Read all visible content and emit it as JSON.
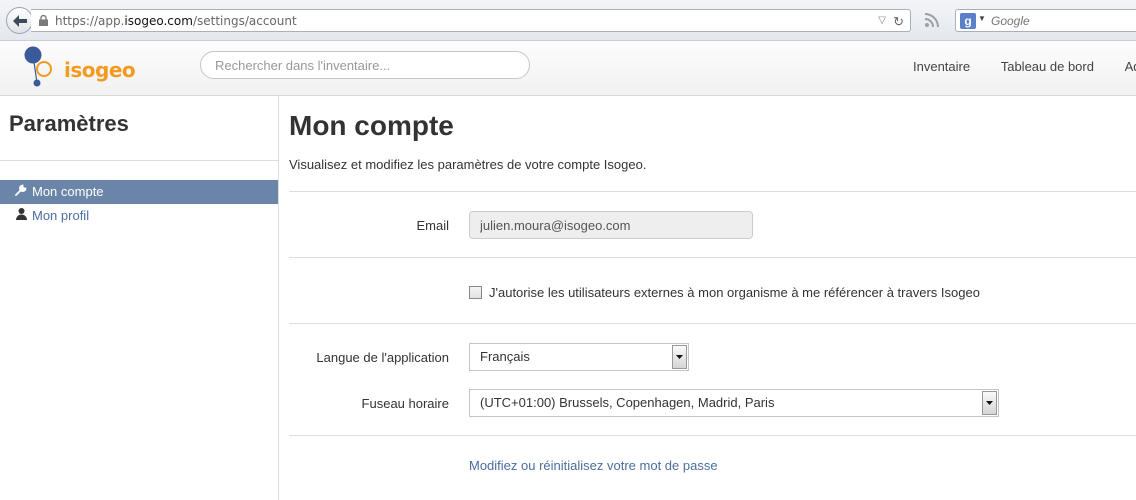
{
  "browser": {
    "url_prefix": "https://app.",
    "url_host": "isogeo.com",
    "url_path": "/settings/account",
    "search_engine_placeholder": "Google"
  },
  "app": {
    "logo_text": "isogeo",
    "search_placeholder": "Rechercher dans l'inventaire...",
    "nav": [
      "Inventaire",
      "Tableau de bord",
      "Adr"
    ]
  },
  "sidebar": {
    "title": "Paramètres",
    "items": [
      {
        "label": "Mon compte",
        "icon": "wrench-icon",
        "active": true
      },
      {
        "label": "Mon profil",
        "icon": "user-icon",
        "active": false
      }
    ]
  },
  "main": {
    "title": "Mon compte",
    "subtitle": "Visualisez et modifiez les paramètres de votre compte Isogeo.",
    "email_label": "Email",
    "email_value": "julien.moura@isogeo.com",
    "checkbox_label": "J'autorise les utilisateurs externes à mon organisme à me référencer à travers Isogeo",
    "checkbox_checked": false,
    "language_label": "Langue de l'application",
    "language_value": "Français",
    "timezone_label": "Fuseau horaire",
    "timezone_value": "(UTC+01:00) Brussels, Copenhagen, Madrid, Paris",
    "password_link": "Modifiez ou réinitialisez votre mot de passe"
  },
  "colors": {
    "accent": "#6b85a8",
    "link": "#4a6ea0",
    "logo_orange": "#f39a1f",
    "logo_blue": "#3b5a99"
  }
}
